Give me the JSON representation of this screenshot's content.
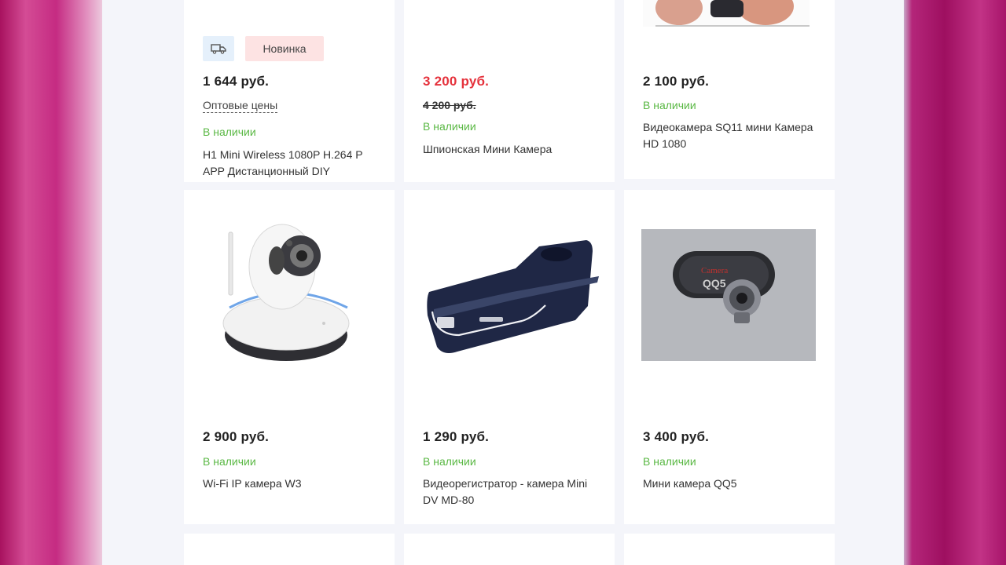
{
  "colors": {
    "accent_sale": "#e5323c",
    "in_stock": "#5ab844",
    "brand_magenta": "#b0206e"
  },
  "products": [
    {
      "price": "1 644 руб.",
      "old_price": "",
      "stock": "В наличии",
      "title": "H1 Mini Wireless 1080P H.264 P APP Дистанционный DIY",
      "wholesale": "Оптовые цены",
      "badges": {
        "delivery_icon": "truck-icon",
        "new_label": "Новинка"
      }
    },
    {
      "price": "3 200 руб.",
      "old_price": "4 200 руб.",
      "stock": "В наличии",
      "title": "Шпионская Мини Камера"
    },
    {
      "price": "2 100 руб.",
      "old_price": "",
      "stock": "В наличии",
      "title": "Видеокамера SQ11 мини Камера HD 1080"
    },
    {
      "price": "2 900 руб.",
      "stock": "В наличии",
      "title": "Wi-Fi IP камера W3",
      "image": "ip-camera-white"
    },
    {
      "price": "1 290 руб.",
      "stock": "В наличии",
      "title": "Видеорегистратор - камера Mini DV MD-80",
      "image": "mini-dv-camera"
    },
    {
      "price": "3 400 руб.",
      "stock": "В наличии",
      "title": "Мини камера QQ5",
      "image": "qq5-camera",
      "image_text": "Camera",
      "image_model": "QQ5"
    }
  ]
}
